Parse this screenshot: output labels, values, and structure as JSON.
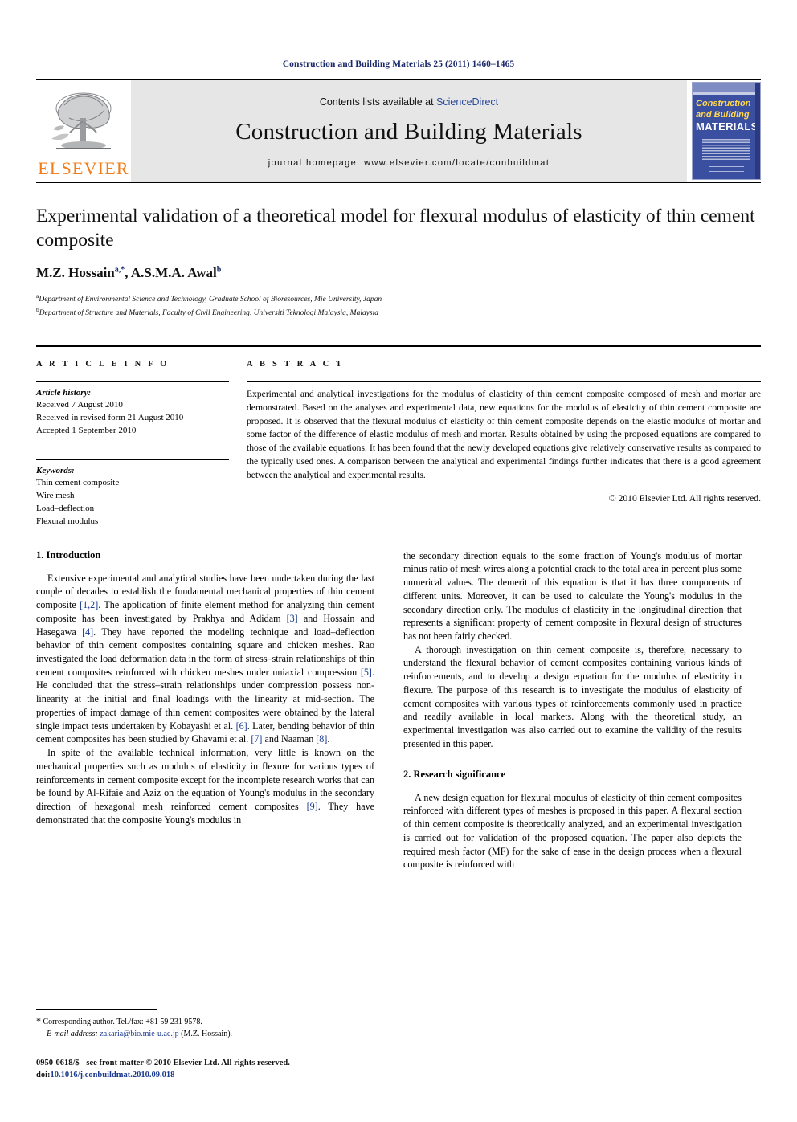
{
  "running_head": "Construction and Building Materials 25 (2011) 1460–1465",
  "masthead": {
    "contents_prefix": "Contents lists available at ",
    "sciencedirect": "ScienceDirect",
    "journal_title": "Construction and Building Materials",
    "homepage": "journal homepage: www.elsevier.com/locate/conbuildmat",
    "publisher_name": "ELSEVIER",
    "cover": {
      "line1": "Construction",
      "line2": "and Building",
      "line3": "MATERIALS"
    },
    "accent_orange": "#f07d1a",
    "cover_blue": "#3b4fa0",
    "link_blue": "#2b4a9b"
  },
  "title": "Experimental validation of a theoretical model for flexural modulus of elasticity of thin cement composite",
  "authors": "M.Z. Hossain, A.S.M.A. Awal",
  "author_marks": {
    "first": "a,*",
    "second": "b"
  },
  "affiliations": [
    {
      "mark": "a",
      "text": "Department of Environmental Science and Technology, Graduate School of Bioresources, Mie University, Japan"
    },
    {
      "mark": "b",
      "text": "Department of Structure and Materials, Faculty of Civil Engineering, Universiti Teknologi Malaysia, Malaysia"
    }
  ],
  "article_info": {
    "label": "A R T I C L E    I N F O",
    "history_label": "Article history:",
    "history": [
      "Received 7 August 2010",
      "Received in revised form 21 August 2010",
      "Accepted 1 September 2010"
    ],
    "keywords_label": "Keywords:",
    "keywords": [
      "Thin cement composite",
      "Wire mesh",
      "Load–deflection",
      "Flexural modulus"
    ]
  },
  "abstract": {
    "label": "A B S T R A C T",
    "text": "Experimental and analytical investigations for the modulus of elasticity of thin cement composite composed of mesh and mortar are demonstrated. Based on the analyses and experimental data, new equations for the modulus of elasticity of thin cement composite are proposed. It is observed that the flexural modulus of elasticity of thin cement composite depends on the elastic modulus of mortar and some factor of the difference of elastic modulus of mesh and mortar. Results obtained by using the proposed equations are compared to those of the available equations. It has been found that the newly developed equations give relatively conservative results as compared to the typically used ones. A comparison between the analytical and experimental findings further indicates that there is a good agreement between the analytical and experimental results.",
    "copyright": "© 2010 Elsevier Ltd. All rights reserved."
  },
  "sections": {
    "introduction_heading": "1. Introduction",
    "intro_p1_a": "Extensive experimental and analytical studies have been undertaken during the last couple of decades to establish the fundamental mechanical properties of thin cement composite ",
    "intro_p1_r1": "[1,2]",
    "intro_p1_b": ". The application of finite element method for analyzing thin cement composite has been investigated by Prakhya and Adidam ",
    "intro_p1_r2": "[3]",
    "intro_p1_c": " and Hossain and Hasegawa ",
    "intro_p1_r3": "[4]",
    "intro_p1_d": ". They have reported the modeling technique and load–deflection behavior of thin cement composites containing square and chicken meshes. Rao investigated the load deformation data in the form of stress–strain relationships of thin cement composites reinforced with chicken meshes under uniaxial compression ",
    "intro_p1_r4": "[5]",
    "intro_p1_e": ". He concluded that the stress–strain relationships under compression possess non-linearity at the initial and final loadings with the linearity at mid-section. The properties of impact damage of thin cement composites were obtained by the lateral single impact tests undertaken by Kobayashi et al. ",
    "intro_p1_r5": "[6]",
    "intro_p1_f": ". Later, bending behavior of thin cement composites has been studied by Ghavami et al. ",
    "intro_p1_r6": "[7]",
    "intro_p1_g": " and Naaman ",
    "intro_p1_r7": "[8]",
    "intro_p1_h": ".",
    "intro_p2_a": "In spite of the available technical information, very little is known on the mechanical properties such as modulus of elasticity in flexure for various types of reinforcements in cement composite except for the incomplete research works that can be found by Al-Rifaie and Aziz on the equation of Young's modulus in the secondary direction of hexagonal mesh reinforced cement composites ",
    "intro_p2_r1": "[9]",
    "intro_p2_b": ". They have demonstrated that the composite Young's modulus in",
    "intro_p3": "the secondary direction equals to the some fraction of Young's modulus of mortar minus ratio of mesh wires along a potential crack to the total area in percent plus some numerical values. The demerit of this equation is that it has three components of different units. Moreover, it can be used to calculate the Young's modulus in the secondary direction only. The modulus of elasticity in the longitudinal direction that represents a significant property of cement composite in flexural design of structures has not been fairly checked.",
    "intro_p4": "A thorough investigation on thin cement composite is, therefore, necessary to understand the flexural behavior of cement composites containing various kinds of reinforcements, and to develop a design equation for the modulus of elasticity in flexure. The purpose of this research is to investigate the modulus of elasticity of cement composites with various types of reinforcements commonly used in practice and readily available in local markets. Along with the theoretical study, an experimental investigation was also carried out to examine the validity of the results presented in this paper.",
    "significance_heading": "2. Research significance",
    "significance_p1": "A new design equation for flexural modulus of elasticity of thin cement composites reinforced with different types of meshes is proposed in this paper. A flexural section of thin cement composite is theoretically analyzed, and an experimental investigation is carried out for validation of the proposed equation. The paper also depicts the required mesh factor (MF) for the sake of ease in the design process when a flexural composite is reinforced with"
  },
  "footnote": {
    "star": "*",
    "corresponding": " Corresponding author. Tel./fax: +81 59 231 9578.",
    "email_label": "E-mail address:",
    "email": "zakaria@bio.mie-u.ac.jp",
    "email_suffix": " (M.Z. Hossain)."
  },
  "footer": {
    "issn_line": "0950-0618/$ - see front matter © 2010 Elsevier Ltd. All rights reserved.",
    "doi_label": "doi:",
    "doi": "10.1016/j.conbuildmat.2010.09.018"
  }
}
